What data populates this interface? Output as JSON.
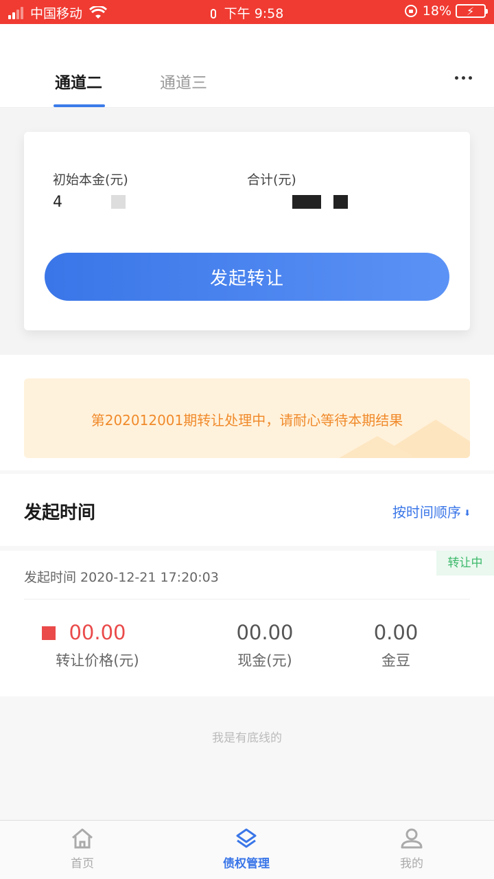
{
  "status_bar": {
    "carrier": "中国移动",
    "time_prefix": "下午",
    "time": "9:58",
    "battery": "18%"
  },
  "tabs": [
    {
      "label": "通道二",
      "active": true
    },
    {
      "label": "通道三",
      "active": false
    }
  ],
  "summary": {
    "principal_label": "初始本金(元)",
    "principal_value": "4",
    "total_label": "合计(元)",
    "submit_label": "发起转让"
  },
  "notice": {
    "text": "第202012001期转让处理中，请耐心等待本期结果"
  },
  "list": {
    "title": "发起时间",
    "sort_label": "按时间顺序",
    "sort_icon": "arrow-down-icon"
  },
  "record": {
    "status_badge": "转让中",
    "time_text": "发起时间 2020-12-21 17:20:03",
    "price_value": "00.00",
    "price_label": "转让价格(元)",
    "cash_value": "00.00",
    "cash_label": "现金(元)",
    "beans_value": "0.00",
    "beans_label": "金豆"
  },
  "footer_text": "我是有底线的",
  "tabbar": [
    {
      "label": "首页",
      "icon": "home-icon",
      "active": false
    },
    {
      "label": "债权管理",
      "icon": "layers-icon",
      "active": true
    },
    {
      "label": "我的",
      "icon": "user-icon",
      "active": false
    }
  ],
  "colors": {
    "status_bar": "#f03b32",
    "accent": "#3a76e8",
    "notice_text": "#f08a2b",
    "price": "#ea4a4a",
    "badge_text": "#3cb86a"
  }
}
